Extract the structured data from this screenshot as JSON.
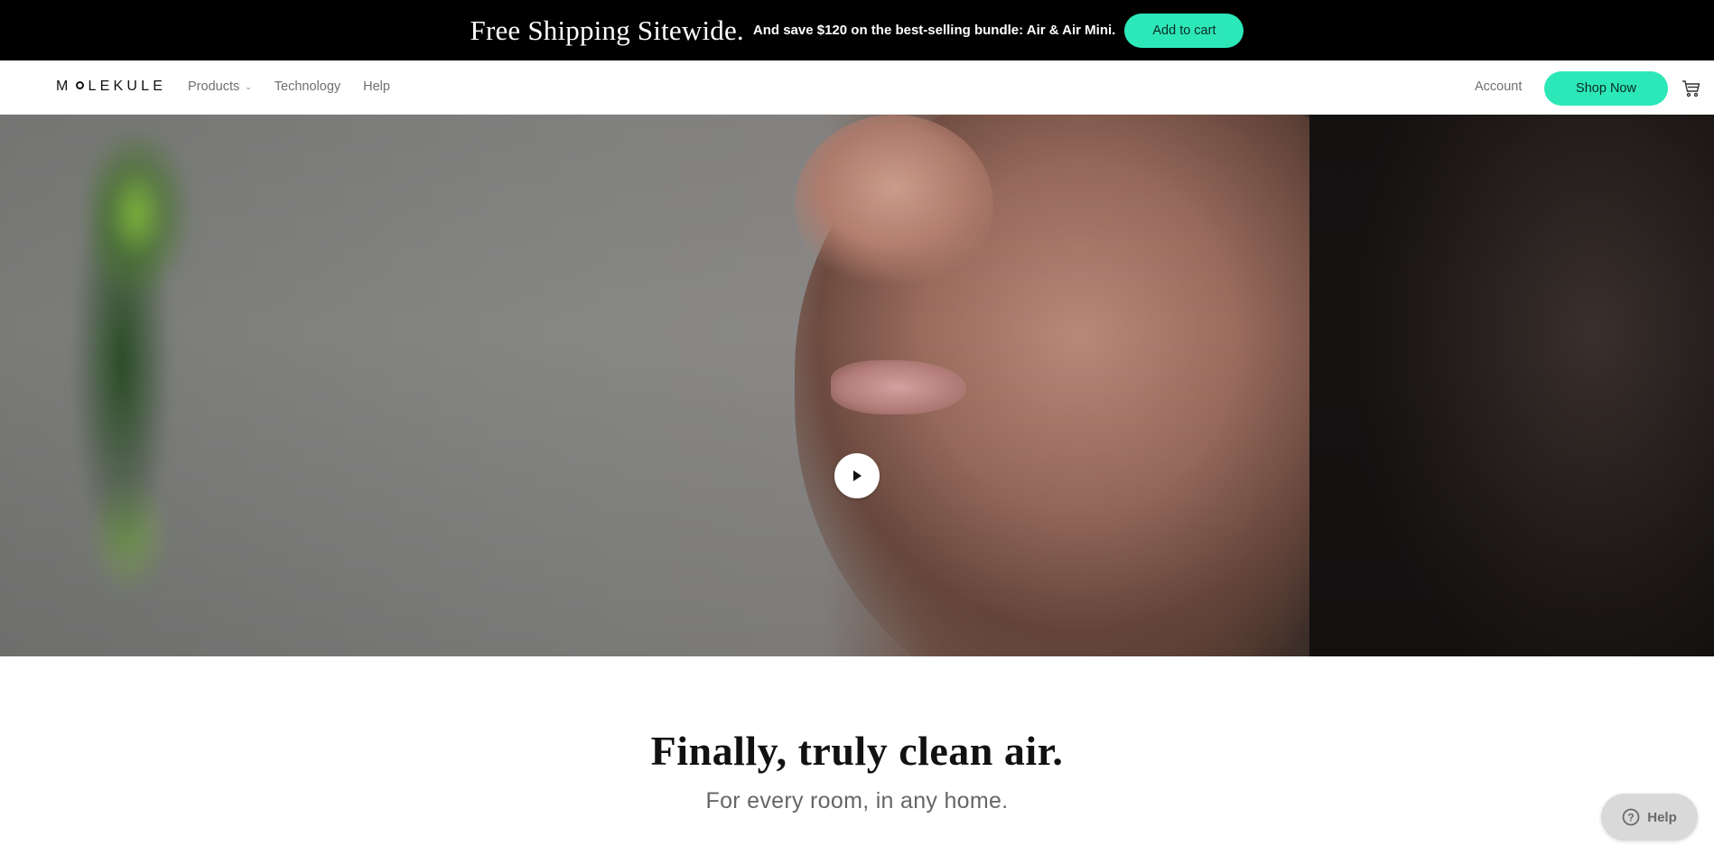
{
  "promo": {
    "headline": "Free Shipping Sitewide.",
    "subtext": "And save $120 on the best-selling bundle: Air & Air Mini.",
    "cta_label": "Add to cart"
  },
  "header": {
    "logo_text_left": "M",
    "logo_text_right": "LEKULE",
    "nav": {
      "products": "Products",
      "technology": "Technology",
      "help": "Help"
    },
    "account_label": "Account",
    "shop_now_label": "Shop Now",
    "cart_icon": "cart-icon"
  },
  "hero": {
    "play_icon": "play-icon"
  },
  "main": {
    "title": "Finally, truly clean air.",
    "subtitle": "For every room, in any home."
  },
  "help_widget": {
    "label": "Help",
    "icon": "question-circle-icon"
  },
  "colors": {
    "accent": "#2ce8b9",
    "promo_bg": "#000000",
    "text_muted": "#6f6f6f"
  }
}
